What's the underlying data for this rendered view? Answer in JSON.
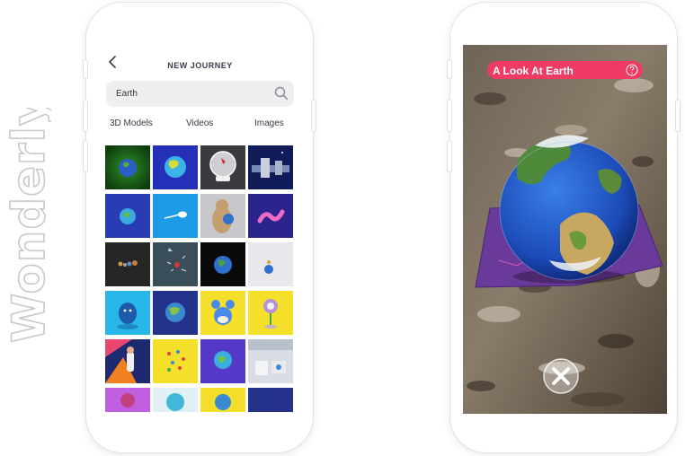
{
  "brand": {
    "name": "Wonderly"
  },
  "left_screen": {
    "back_icon": "chevron-left-icon",
    "title": "NEW JOURNEY",
    "search": {
      "value": "Earth",
      "icon": "search-icon"
    },
    "tabs": [
      {
        "label": "3D Models"
      },
      {
        "label": "Videos"
      },
      {
        "label": "Images"
      }
    ],
    "results": [
      "earth-dark-green",
      "earth-blue-glow",
      "snow-globe",
      "space-station",
      "earth-blue",
      "light-bulb",
      "beaver-holding-earth",
      "pink-worm",
      "solar-system",
      "space-debris",
      "earth-black-bg",
      "small-figure",
      "blue-creature",
      "earth-navy",
      "marill-pokemon",
      "flower-lamp",
      "rocket-character",
      "yellow-pattern",
      "earth-purple",
      "lab-room",
      "purple-thumb",
      "cyan-thumb",
      "yellow-thumb",
      "navy-thumb"
    ]
  },
  "right_screen": {
    "title": "A Look At Earth",
    "help_icon": "question-circle-icon",
    "close_icon": "close-x-icon"
  },
  "colors": {
    "accent_pink": "#ef3b63",
    "text_dark": "#3a3a48",
    "search_bg": "#efeff1"
  }
}
